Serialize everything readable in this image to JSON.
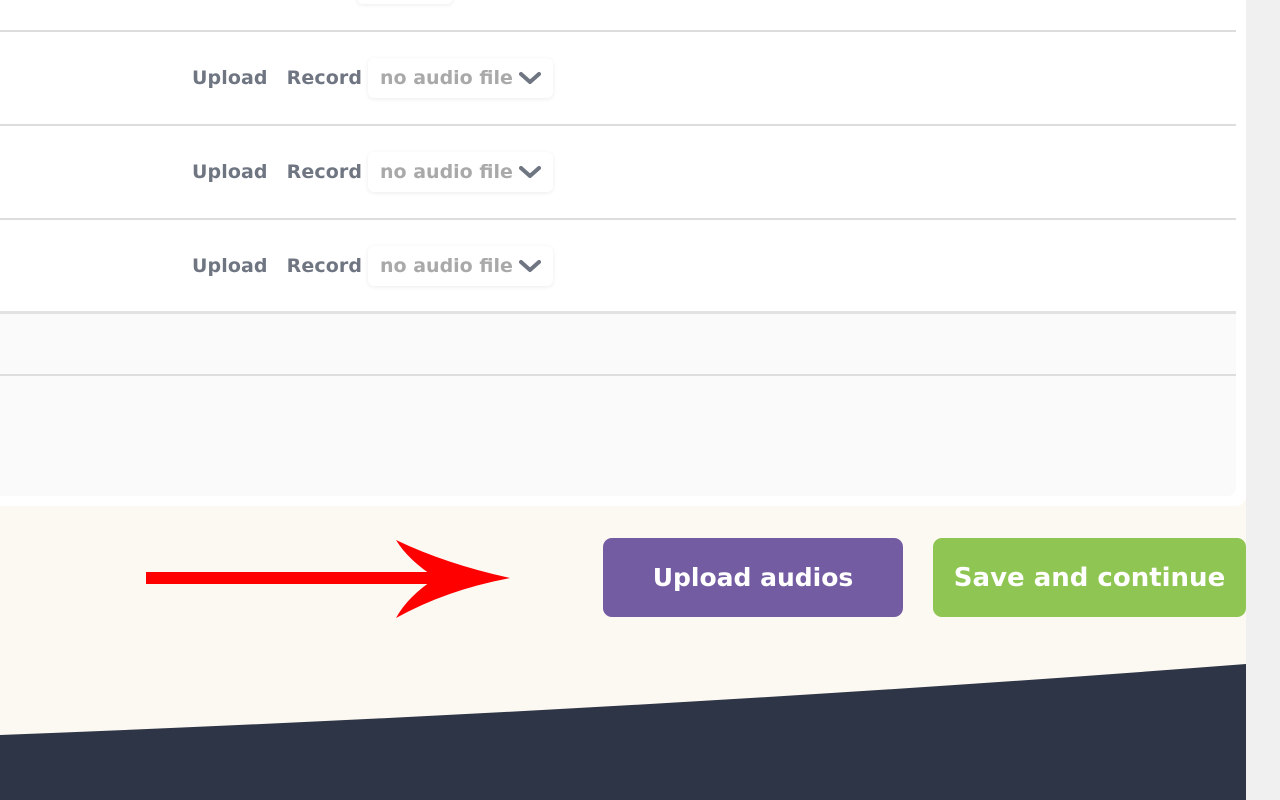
{
  "rows": [
    {
      "upload_label": "Upload",
      "record_label": "Record",
      "audio_select": "no audio file"
    },
    {
      "upload_label": "Upload",
      "record_label": "Record",
      "audio_select": "no audio file"
    },
    {
      "upload_label": "Upload",
      "record_label": "Record",
      "audio_select": "no audio file"
    }
  ],
  "actions": {
    "upload_audios_label": "Upload audios",
    "save_continue_label": "Save and continue"
  },
  "colors": {
    "upload_button": "#745ca3",
    "save_button": "#8fc552",
    "annotation_arrow": "#ff0000",
    "footer_dark": "#2e3546",
    "page_background": "#fcf9f2"
  },
  "icons": {
    "select_chevron": "chevron-down-icon",
    "annotation": "arrow-right-icon"
  }
}
